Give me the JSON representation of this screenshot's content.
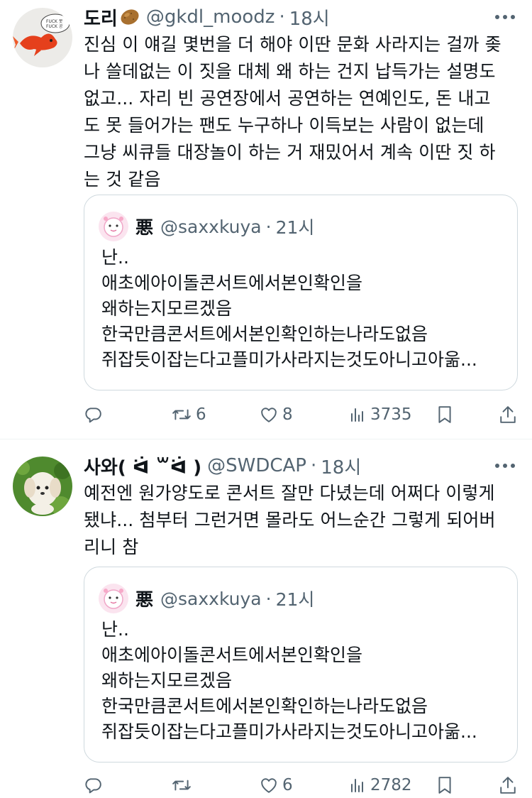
{
  "tweets": [
    {
      "display_name": "도리",
      "name_emoji": "potato-icon",
      "handle": "@gkdl_moodz",
      "separator": "·",
      "time": "18시",
      "text": "진심 이 얘길 몇번을 더 해야 이딴 문화 사라지는 걸까 좆\n나 쓸데없는 이 짓을 대체 왜 하는 건지 납득가는 설명도\n없고... 자리 빈 공연장에서 공연하는 연예인도, 돈 내고\n도 못 들어가는 팬도 누구하나 이득보는 사람이 없는데\n그냥 씨큐들 대장놀이 하는 거 재밌어서 계속 이딴 짓 하\n는 것 같음",
      "quote": {
        "display_name": "悪",
        "handle": "@saxxkuya",
        "separator": "·",
        "time": "21시",
        "text": "난..\n애초에아이돌콘서트에서본인확인을\n왜하는지모르겠음\n한국만큼콘서트에서본인확인하는나라도없음\n쥐잡듯이잡는다고플미가사라지는것도아니고아욺..."
      },
      "stats": {
        "replies": "",
        "retweets": "6",
        "likes": "8",
        "views": "3735"
      }
    },
    {
      "display_name": "사와( ᐛ ꒳ᐛ )",
      "handle": "@SWDCAP",
      "separator": "·",
      "time": "18시",
      "text": "예전엔 원가양도로 콘서트 잘만 다녔는데 어쩌다 이렇게\n됐냐... 첨부터 그런거면 몰라도 어느순간 그렇게 되어버\n리니 참",
      "quote": {
        "display_name": "悪",
        "handle": "@saxxkuya",
        "separator": "·",
        "time": "21시",
        "text": "난..\n애초에아이돌콘서트에서본인확인을\n왜하는지모르겠음\n한국만큼콘서트에서본인확인하는나라도없음\n쥐잡듯이잡는다고플미가사라지는것도아니고아욺..."
      },
      "stats": {
        "replies": "",
        "retweets": "",
        "likes": "6",
        "views": "2782"
      }
    }
  ],
  "icons": {
    "reply": "reply-icon",
    "retweet": "retweet-icon",
    "like": "heart-icon",
    "views": "views-icon",
    "bookmark": "bookmark-icon",
    "share": "share-icon",
    "more": "more-icon"
  },
  "colors": {
    "text": "#0f1419",
    "secondary": "#536471",
    "border": "#cfd9de"
  }
}
